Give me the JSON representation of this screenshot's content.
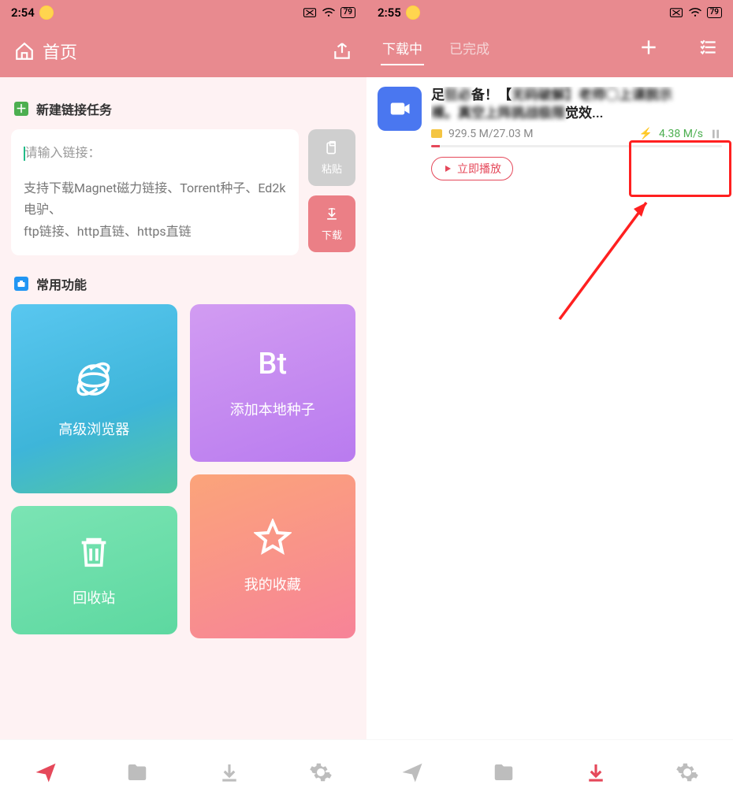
{
  "left": {
    "status": {
      "time": "2:54",
      "battery": "79"
    },
    "header": {
      "title": "首页"
    },
    "new_task": {
      "section_label": "新建链接任务",
      "placeholder": "请输入链接：",
      "hint_line1": "支持下载Magnet磁力链接、Torrent种子、Ed2k电驴、",
      "hint_line2": "ftp链接、http直链、https直链",
      "paste_label": "粘贴",
      "download_label": "下载"
    },
    "features": {
      "section_label": "常用功能",
      "browser": "高级浏览器",
      "bt_title": "Bt",
      "bt_sub": "添加本地种子",
      "recycle": "回收站",
      "favorites": "我的收藏"
    }
  },
  "right": {
    "status": {
      "time": "2:55",
      "battery": "79"
    },
    "tabs": {
      "downloading": "下载中",
      "completed": "已完成"
    },
    "item": {
      "title_visible_prefix": "足",
      "title_visible_mid": "备！【",
      "title_line2_suffix": "觉效...",
      "size": "929.5 M/27.03 M",
      "speed": "4.38 M/s",
      "play": "立即播放"
    }
  }
}
